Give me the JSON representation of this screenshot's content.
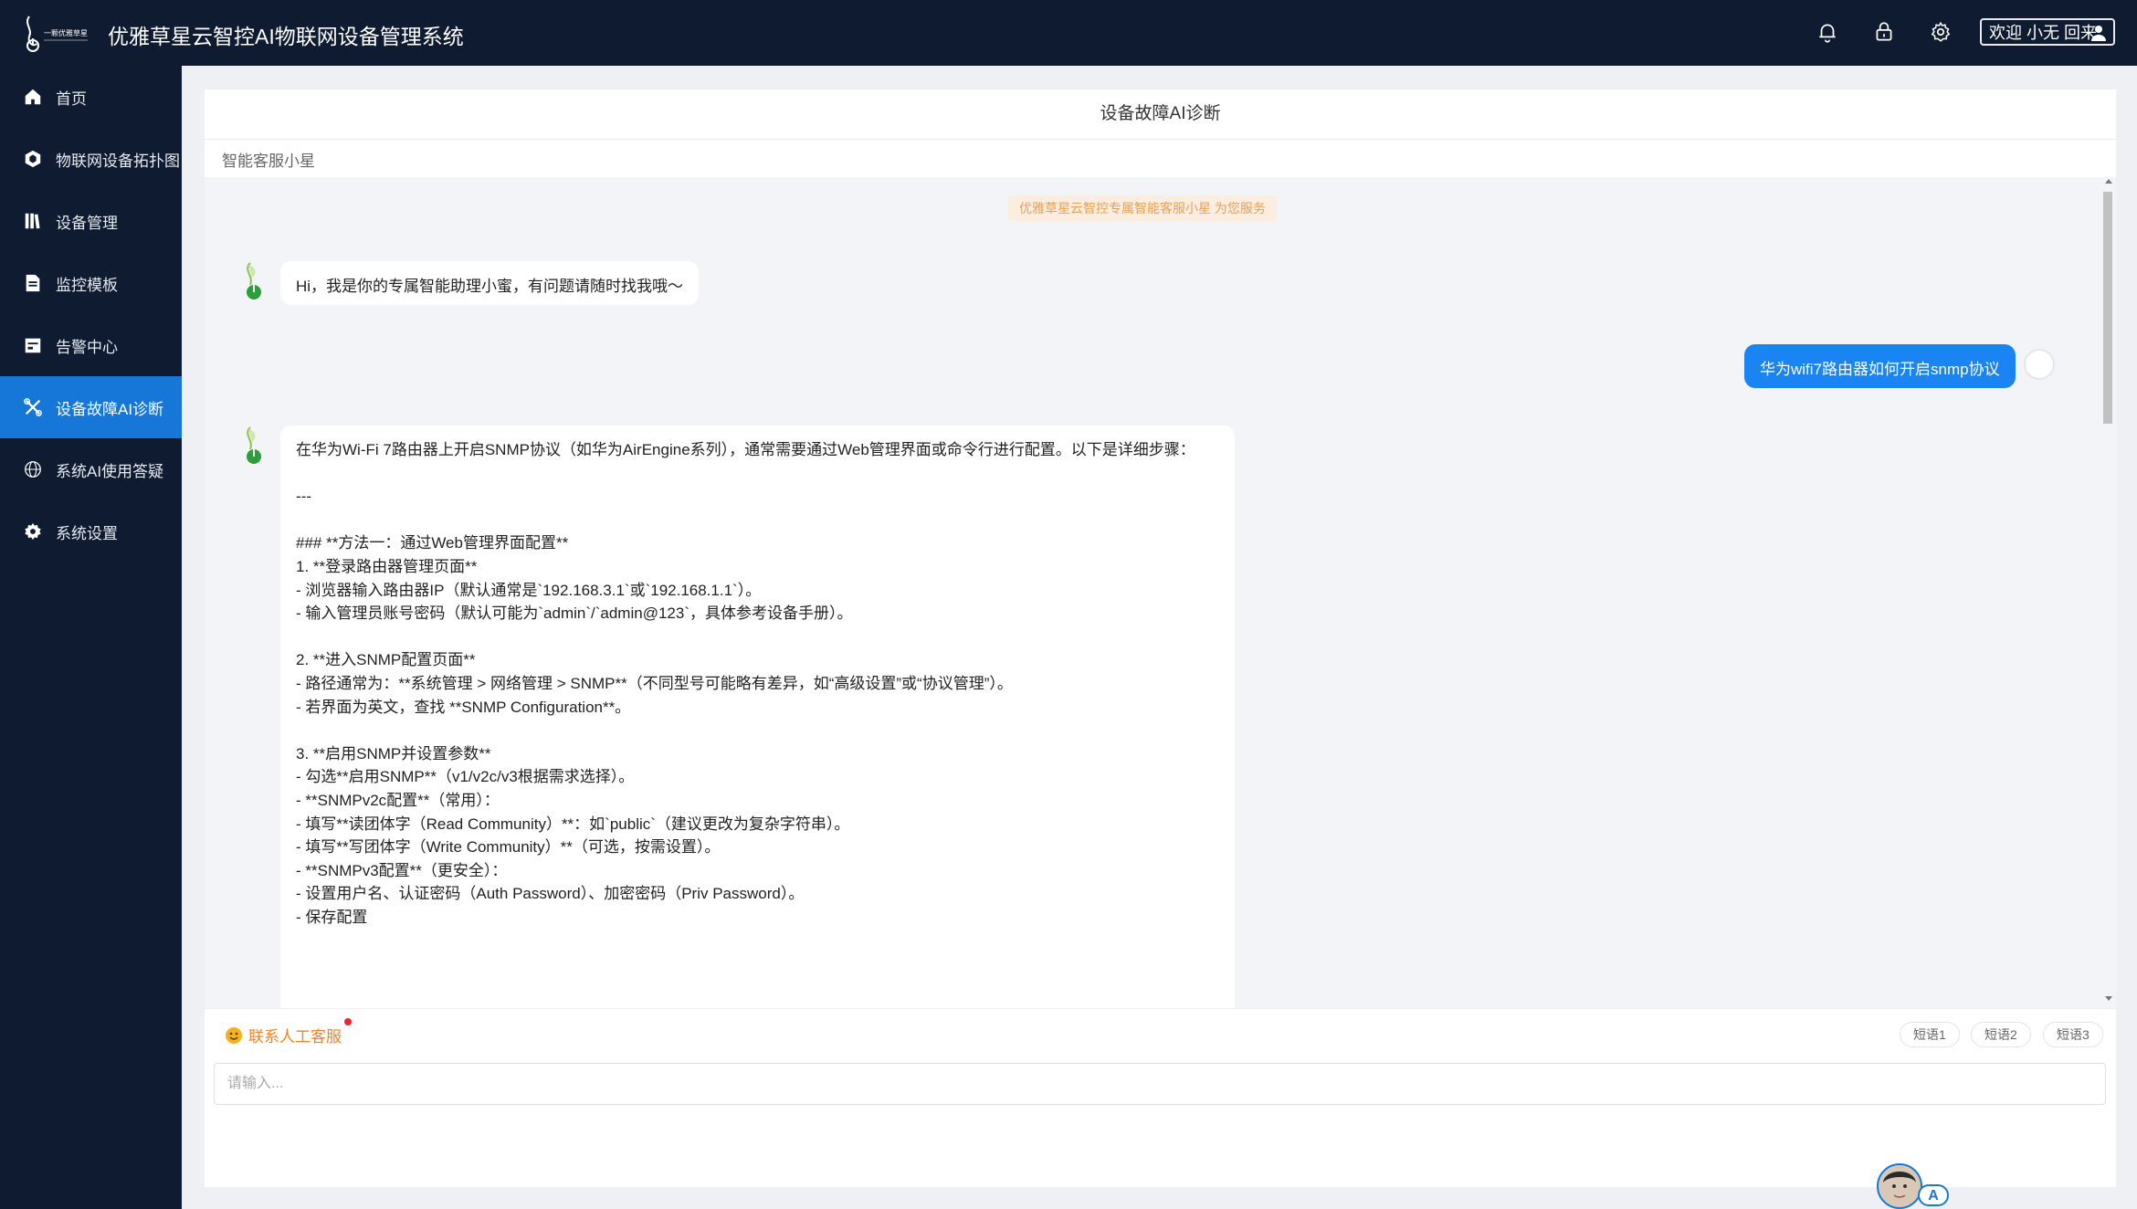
{
  "header": {
    "logo_text": "一颗优雅草星",
    "app_title": "优雅草星云智控AI物联网设备管理系统",
    "icons": [
      "bell-icon",
      "lock-icon",
      "gear-icon"
    ],
    "welcome": "欢迎 小无 回来"
  },
  "sidebar": {
    "items": [
      {
        "label": "首页",
        "icon": "home-icon"
      },
      {
        "label": "物联网设备拓扑图",
        "icon": "cube-icon"
      },
      {
        "label": "设备管理",
        "icon": "books-icon"
      },
      {
        "label": "监控模板",
        "icon": "document-icon"
      },
      {
        "label": "告警中心",
        "icon": "calendar-icon"
      },
      {
        "label": "设备故障AI诊断",
        "icon": "tools-icon",
        "active": true
      },
      {
        "label": "系统AI使用答疑",
        "icon": "globe-icon"
      },
      {
        "label": "系统设置",
        "icon": "gear-icon"
      }
    ]
  },
  "main": {
    "title": "设备故障AI诊断",
    "bot_name": "智能客服小星"
  },
  "chat": {
    "notice": "优雅草星云智控专属智能客服小星 为您服务",
    "messages": [
      {
        "role": "bot",
        "text": "Hi，我是你的专属智能助理小蜜，有问题请随时找我哦～"
      },
      {
        "role": "user",
        "text": "华为wifi7路由器如何开启snmp协议"
      },
      {
        "role": "bot",
        "text": "在华为Wi-Fi 7路由器上开启SNMP协议（如华为AirEngine系列），通常需要通过Web管理界面或命令行进行配置。以下是详细步骤：\n\n---\n\n### **方法一：通过Web管理界面配置**\n1. **登录路由器管理页面**\n- 浏览器输入路由器IP（默认通常是`192.168.3.1`或`192.168.1.1`）。\n- 输入管理员账号密码（默认可能为`admin`/`admin@123`，具体参考设备手册）。\n\n2. **进入SNMP配置页面**\n- 路径通常为：**系统管理 > 网络管理 > SNMP**（不同型号可能略有差异，如“高级设置”或“协议管理”）。\n- 若界面为英文，查找 **SNMP Configuration**。\n\n3. **启用SNMP并设置参数**\n- 勾选**启用SNMP**（v1/v2c/v3根据需求选择）。\n- **SNMPv2c配置**（常用）：\n- 填写**读团体字（Read Community）**：如`public`（建议更改为复杂字符串）。\n- 填写**写团体字（Write Community）**（可选，按需设置）。\n- **SNMPv3配置**（更安全）：\n- 设置用户名、认证密码（Auth Password）、加密密码（Priv Password）。\n- 保存配置"
      }
    ]
  },
  "footer": {
    "contact_label": "联系人工客服",
    "phrases": [
      "短语1",
      "短语2",
      "短语3"
    ],
    "input_placeholder": "请输入..."
  },
  "floating": {
    "badge": "A"
  },
  "colors": {
    "sidebar_bg": "#0f1b30",
    "accent": "#1677d9",
    "user_bubble": "#1a85f2",
    "contact": "#f5821f",
    "notice_text": "#e3a15a"
  }
}
